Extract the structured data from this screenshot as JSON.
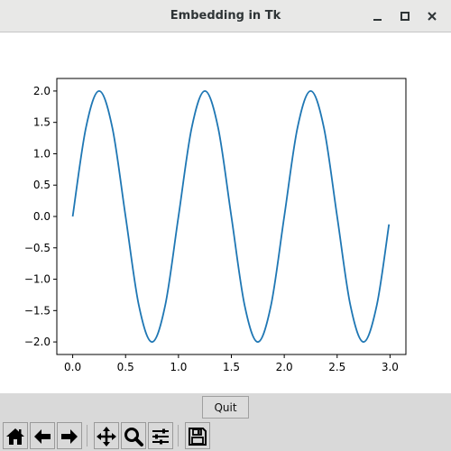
{
  "window": {
    "title": "Embedding in Tk",
    "controls": [
      "minimize-icon",
      "maximize-icon",
      "close-icon"
    ]
  },
  "quit_button": {
    "label": "Quit"
  },
  "toolbar": {
    "buttons": [
      "home-icon",
      "back-arrow-icon",
      "forward-arrow-icon",
      "pan-icon",
      "zoom-icon",
      "configure-subplots-icon",
      "save-icon"
    ]
  },
  "colors": {
    "line": "#1f77b4"
  },
  "chart_data": {
    "type": "line",
    "title": "",
    "xlabel": "",
    "ylabel": "",
    "xlim": [
      -0.15,
      3.15
    ],
    "ylim": [
      -2.2,
      2.2
    ],
    "xticks": [
      0.0,
      0.5,
      1.0,
      1.5,
      2.0,
      2.5,
      3.0
    ],
    "xtick_labels": [
      "0.0",
      "0.5",
      "1.0",
      "1.5",
      "2.0",
      "2.5",
      "3.0"
    ],
    "yticks": [
      2.0,
      1.5,
      1.0,
      0.5,
      0.0,
      -0.5,
      -1.0,
      -1.5,
      -2.0
    ],
    "ytick_labels": [
      "2.0",
      "1.5",
      "1.0",
      "0.5",
      "0.0",
      "−0.5",
      "−1.0",
      "−1.5",
      "−2.0"
    ],
    "grid": false,
    "legend": "none",
    "series": [
      {
        "x": [
          0,
          0.125,
          0.25,
          0.375,
          0.5,
          0.625,
          0.75,
          0.875,
          1.0,
          1.125,
          1.25,
          1.375,
          1.5,
          1.625,
          1.75,
          1.875,
          2.0,
          2.125,
          2.25,
          2.375,
          2.5,
          2.625,
          2.75,
          2.875,
          2.99
        ],
        "y": [
          0,
          1.414,
          2.0,
          1.414,
          0,
          -1.414,
          -2.0,
          -1.414,
          0,
          1.414,
          2.0,
          1.414,
          0,
          -1.414,
          -2.0,
          -1.414,
          0,
          1.414,
          2.0,
          1.414,
          0,
          -1.414,
          -2.0,
          -1.414,
          -0.126
        ]
      }
    ]
  }
}
